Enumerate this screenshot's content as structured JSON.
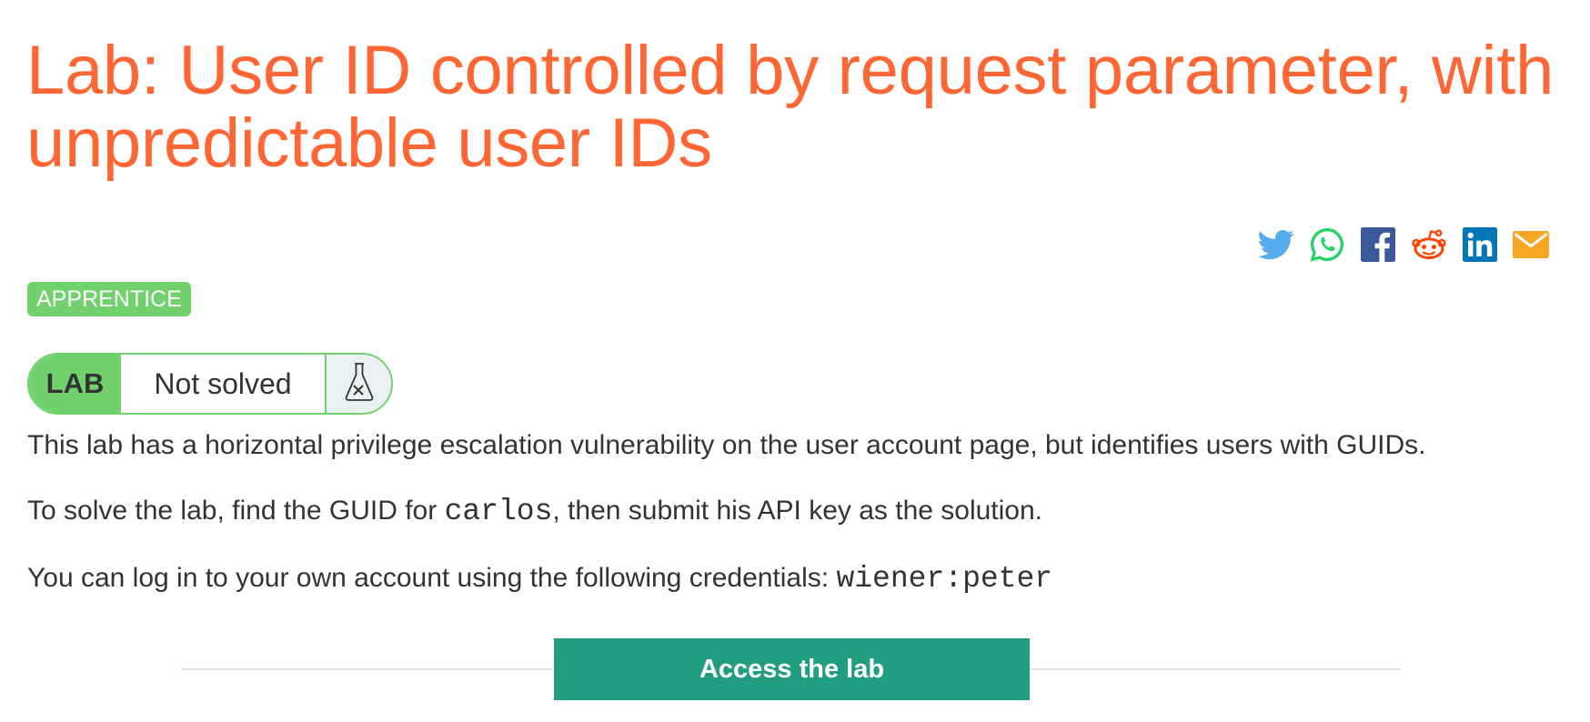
{
  "page": {
    "title": "Lab: User ID controlled by request parameter, with unpredictable user IDs"
  },
  "share": {
    "icons": [
      "twitter-icon",
      "whatsapp-icon",
      "facebook-icon",
      "reddit-icon",
      "linkedin-icon",
      "email-icon"
    ],
    "colors": {
      "twitter": "#55acee",
      "whatsapp": "#25d366",
      "facebook": "#3b5998",
      "reddit": "#ff4500",
      "linkedin": "#0077b5",
      "email": "#f5a623"
    }
  },
  "level": {
    "label": "APPRENTICE",
    "color": "#70d16d"
  },
  "lab_status": {
    "lab_label": "LAB",
    "status": "Not solved",
    "icon": "flask-icon"
  },
  "description": {
    "p1": "This lab has a horizontal privilege escalation vulnerability on the user account page, but identifies users with GUIDs.",
    "p2_before": "To solve the lab, find the GUID for ",
    "p2_code": "carlos",
    "p2_after": ", then submit his API key as the solution.",
    "p3_before": "You can log in to your own account using the following credentials: ",
    "p3_code": "wiener:peter"
  },
  "actions": {
    "access_lab": "Access the lab"
  },
  "colors": {
    "title": "#ff6633",
    "button": "#219e82",
    "text": "#333332"
  }
}
